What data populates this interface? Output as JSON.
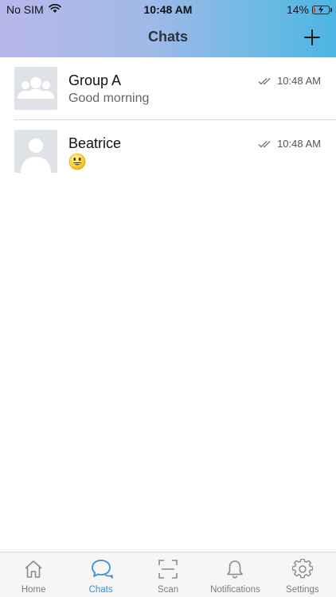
{
  "status_bar": {
    "carrier": "No SIM",
    "time": "10:48 AM",
    "battery": "14%",
    "battery_level": 0.14
  },
  "header": {
    "title": "Chats",
    "add_icon": "plus-icon"
  },
  "chats": [
    {
      "name": "Group A",
      "preview": "Good morning",
      "time": "10:48 AM",
      "avatar": "group-avatar-icon",
      "read_icon": "double-check-icon"
    },
    {
      "name": "Beatrice",
      "preview_emoji": "smiley-emoji",
      "time": "10:48 AM",
      "avatar": "person-avatar-icon",
      "read_icon": "double-check-icon"
    }
  ],
  "tabs": [
    {
      "label": "Home",
      "icon": "home-icon"
    },
    {
      "label": "Chats",
      "icon": "chat-bubbles-icon",
      "active": true
    },
    {
      "label": "Scan",
      "icon": "scan-icon"
    },
    {
      "label": "Notifications",
      "icon": "bell-icon"
    },
    {
      "label": "Settings",
      "icon": "gear-icon"
    }
  ],
  "colors": {
    "accent": "#3b8fd0",
    "header_gradient_start": "#b7b8ea",
    "header_gradient_end": "#4cb5e3",
    "battery_low": "#e53935"
  }
}
